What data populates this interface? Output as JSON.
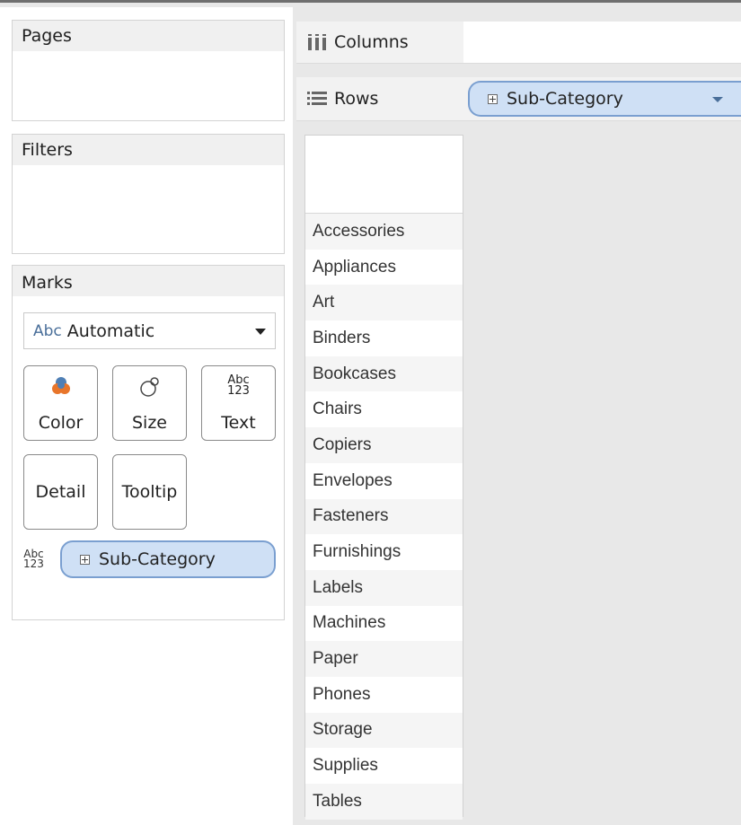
{
  "pages": {
    "title": "Pages"
  },
  "filters": {
    "title": "Filters"
  },
  "marks": {
    "title": "Marks",
    "type_icon": "Abc",
    "type_label": "Automatic",
    "buttons": [
      {
        "label": "Color",
        "icon": "color-icon"
      },
      {
        "label": "Size",
        "icon": "size-icon"
      },
      {
        "label": "Text",
        "icon": "text-icon",
        "icon_top": "Abc",
        "icon_bottom": "123"
      },
      {
        "label": "Detail"
      },
      {
        "label": "Tooltip"
      }
    ],
    "field": {
      "icon_top": "Abc",
      "icon_bottom": "123",
      "label": "Sub-Category"
    }
  },
  "columns": {
    "label": "Columns"
  },
  "rows": {
    "label": "Rows",
    "pill": "Sub-Category"
  },
  "row_headers": [
    "Accessories",
    "Appliances",
    "Art",
    "Binders",
    "Bookcases",
    "Chairs",
    "Copiers",
    "Envelopes",
    "Fasteners",
    "Furnishings",
    "Labels",
    "Machines",
    "Paper",
    "Phones",
    "Storage",
    "Supplies",
    "Tables"
  ],
  "colors": {
    "pill_fill": "#cfe0f5",
    "pill_border": "#7a9fd0",
    "accent": "#4a6f9a"
  }
}
